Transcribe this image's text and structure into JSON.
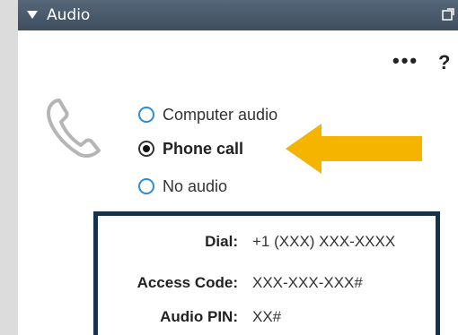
{
  "header": {
    "title": "Audio",
    "bg_color": "#4a5a6a"
  },
  "toolbar": {
    "more_label": "•••",
    "help_label": "?"
  },
  "audio_options": [
    {
      "label": "Computer audio",
      "selected": false
    },
    {
      "label": "Phone call",
      "selected": true
    },
    {
      "label": "No audio",
      "selected": false
    }
  ],
  "dial_info": {
    "dial_label": "Dial:",
    "dial_value": "+1 (XXX) XXX-XXXX",
    "access_label": "Access Code:",
    "access_value": "XXX-XXX-XXX#",
    "pin_label": "Audio PIN:",
    "pin_value": "XX#"
  },
  "colors": {
    "radio_accent": "#2f8ad8",
    "arrow": "#f5b400",
    "box_border": "#16334d"
  }
}
